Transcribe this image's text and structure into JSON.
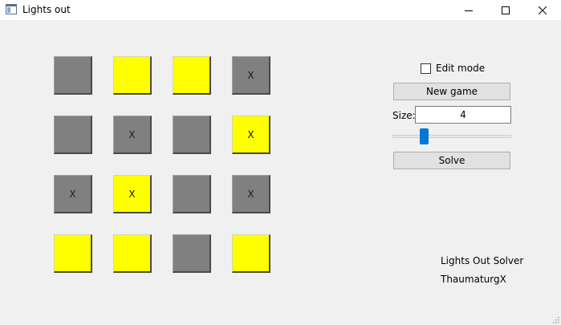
{
  "window": {
    "title": "Lights out",
    "icon": "window-app-icon"
  },
  "board": {
    "size": 4,
    "cells": [
      {
        "on": false,
        "mark": ""
      },
      {
        "on": true,
        "mark": ""
      },
      {
        "on": true,
        "mark": ""
      },
      {
        "on": false,
        "mark": "X"
      },
      {
        "on": false,
        "mark": ""
      },
      {
        "on": false,
        "mark": "X"
      },
      {
        "on": false,
        "mark": ""
      },
      {
        "on": true,
        "mark": "X"
      },
      {
        "on": false,
        "mark": "X"
      },
      {
        "on": true,
        "mark": "X"
      },
      {
        "on": false,
        "mark": ""
      },
      {
        "on": false,
        "mark": "X"
      },
      {
        "on": true,
        "mark": ""
      },
      {
        "on": true,
        "mark": ""
      },
      {
        "on": false,
        "mark": ""
      },
      {
        "on": true,
        "mark": ""
      }
    ],
    "colors": {
      "on": "#ffff00",
      "off": "#808080"
    }
  },
  "controls": {
    "edit_mode_label": "Edit mode",
    "edit_mode_checked": false,
    "new_game_label": "New game",
    "size_label": "Size:",
    "size_value": "4",
    "slider_fraction": 0.25,
    "solve_label": "Solve"
  },
  "footer": {
    "line1": "Lights Out Solver",
    "line2": "ThaumaturgX"
  },
  "accent_color": "#0078d7"
}
